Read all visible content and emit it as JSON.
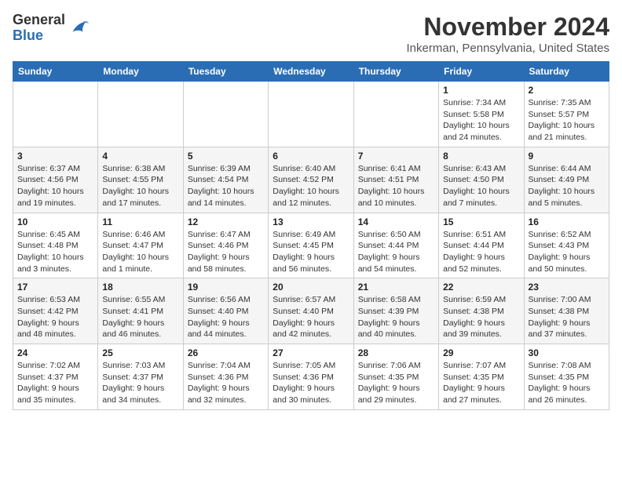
{
  "header": {
    "logo_line1": "General",
    "logo_line2": "Blue",
    "month_title": "November 2024",
    "location": "Inkerman, Pennsylvania, United States"
  },
  "days_of_week": [
    "Sunday",
    "Monday",
    "Tuesday",
    "Wednesday",
    "Thursday",
    "Friday",
    "Saturday"
  ],
  "weeks": [
    [
      {
        "day": "",
        "info": ""
      },
      {
        "day": "",
        "info": ""
      },
      {
        "day": "",
        "info": ""
      },
      {
        "day": "",
        "info": ""
      },
      {
        "day": "",
        "info": ""
      },
      {
        "day": "1",
        "info": "Sunrise: 7:34 AM\nSunset: 5:58 PM\nDaylight: 10 hours and 24 minutes."
      },
      {
        "day": "2",
        "info": "Sunrise: 7:35 AM\nSunset: 5:57 PM\nDaylight: 10 hours and 21 minutes."
      }
    ],
    [
      {
        "day": "3",
        "info": "Sunrise: 6:37 AM\nSunset: 4:56 PM\nDaylight: 10 hours and 19 minutes."
      },
      {
        "day": "4",
        "info": "Sunrise: 6:38 AM\nSunset: 4:55 PM\nDaylight: 10 hours and 17 minutes."
      },
      {
        "day": "5",
        "info": "Sunrise: 6:39 AM\nSunset: 4:54 PM\nDaylight: 10 hours and 14 minutes."
      },
      {
        "day": "6",
        "info": "Sunrise: 6:40 AM\nSunset: 4:52 PM\nDaylight: 10 hours and 12 minutes."
      },
      {
        "day": "7",
        "info": "Sunrise: 6:41 AM\nSunset: 4:51 PM\nDaylight: 10 hours and 10 minutes."
      },
      {
        "day": "8",
        "info": "Sunrise: 6:43 AM\nSunset: 4:50 PM\nDaylight: 10 hours and 7 minutes."
      },
      {
        "day": "9",
        "info": "Sunrise: 6:44 AM\nSunset: 4:49 PM\nDaylight: 10 hours and 5 minutes."
      }
    ],
    [
      {
        "day": "10",
        "info": "Sunrise: 6:45 AM\nSunset: 4:48 PM\nDaylight: 10 hours and 3 minutes."
      },
      {
        "day": "11",
        "info": "Sunrise: 6:46 AM\nSunset: 4:47 PM\nDaylight: 10 hours and 1 minute."
      },
      {
        "day": "12",
        "info": "Sunrise: 6:47 AM\nSunset: 4:46 PM\nDaylight: 9 hours and 58 minutes."
      },
      {
        "day": "13",
        "info": "Sunrise: 6:49 AM\nSunset: 4:45 PM\nDaylight: 9 hours and 56 minutes."
      },
      {
        "day": "14",
        "info": "Sunrise: 6:50 AM\nSunset: 4:44 PM\nDaylight: 9 hours and 54 minutes."
      },
      {
        "day": "15",
        "info": "Sunrise: 6:51 AM\nSunset: 4:44 PM\nDaylight: 9 hours and 52 minutes."
      },
      {
        "day": "16",
        "info": "Sunrise: 6:52 AM\nSunset: 4:43 PM\nDaylight: 9 hours and 50 minutes."
      }
    ],
    [
      {
        "day": "17",
        "info": "Sunrise: 6:53 AM\nSunset: 4:42 PM\nDaylight: 9 hours and 48 minutes."
      },
      {
        "day": "18",
        "info": "Sunrise: 6:55 AM\nSunset: 4:41 PM\nDaylight: 9 hours and 46 minutes."
      },
      {
        "day": "19",
        "info": "Sunrise: 6:56 AM\nSunset: 4:40 PM\nDaylight: 9 hours and 44 minutes."
      },
      {
        "day": "20",
        "info": "Sunrise: 6:57 AM\nSunset: 4:40 PM\nDaylight: 9 hours and 42 minutes."
      },
      {
        "day": "21",
        "info": "Sunrise: 6:58 AM\nSunset: 4:39 PM\nDaylight: 9 hours and 40 minutes."
      },
      {
        "day": "22",
        "info": "Sunrise: 6:59 AM\nSunset: 4:38 PM\nDaylight: 9 hours and 39 minutes."
      },
      {
        "day": "23",
        "info": "Sunrise: 7:00 AM\nSunset: 4:38 PM\nDaylight: 9 hours and 37 minutes."
      }
    ],
    [
      {
        "day": "24",
        "info": "Sunrise: 7:02 AM\nSunset: 4:37 PM\nDaylight: 9 hours and 35 minutes."
      },
      {
        "day": "25",
        "info": "Sunrise: 7:03 AM\nSunset: 4:37 PM\nDaylight: 9 hours and 34 minutes."
      },
      {
        "day": "26",
        "info": "Sunrise: 7:04 AM\nSunset: 4:36 PM\nDaylight: 9 hours and 32 minutes."
      },
      {
        "day": "27",
        "info": "Sunrise: 7:05 AM\nSunset: 4:36 PM\nDaylight: 9 hours and 30 minutes."
      },
      {
        "day": "28",
        "info": "Sunrise: 7:06 AM\nSunset: 4:35 PM\nDaylight: 9 hours and 29 minutes."
      },
      {
        "day": "29",
        "info": "Sunrise: 7:07 AM\nSunset: 4:35 PM\nDaylight: 9 hours and 27 minutes."
      },
      {
        "day": "30",
        "info": "Sunrise: 7:08 AM\nSunset: 4:35 PM\nDaylight: 9 hours and 26 minutes."
      }
    ]
  ]
}
